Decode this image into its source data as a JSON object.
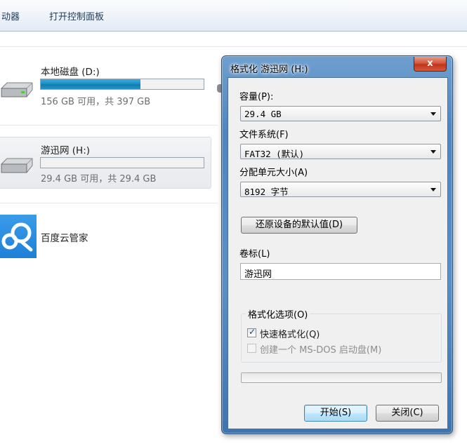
{
  "toolbar": {
    "left_label": "动器",
    "control_panel_label": "打开控制面板"
  },
  "drives": [
    {
      "name": "本地磁盘 (D:)",
      "space": "156 GB 可用，共 397 GB",
      "used_fraction": 0.61
    },
    {
      "name": "游迅网 (H:)",
      "space": "29.4 GB 可用，共 29.4 GB",
      "used_fraction": 0.0
    }
  ],
  "baidu": {
    "label": "百度云管家"
  },
  "dialog": {
    "title": "格式化 游迅网 (H:)",
    "close_label": "x",
    "capacity_label": "容量(P):",
    "capacity_value": "29.4 GB",
    "filesystem_label": "文件系统(F)",
    "filesystem_value": "FAT32 (默认)",
    "cluster_label": "分配单元大小(A)",
    "cluster_value": "8192 字节",
    "restore_button": "还原设备的默认值(D)",
    "volume_label": "卷标(L)",
    "volume_value": "游迅网",
    "options_group": "格式化选项(O)",
    "quick_format": "快速格式化(Q)",
    "msdos_disk": "创建一个 MS-DOS 启动盘(M)",
    "start_button": "开始(S)",
    "close_button": "关闭(C)"
  },
  "colors": {
    "drive_bar": "#1f8fc4",
    "dialog_frame": "#4f86c0",
    "close_button": "#c0341a"
  }
}
